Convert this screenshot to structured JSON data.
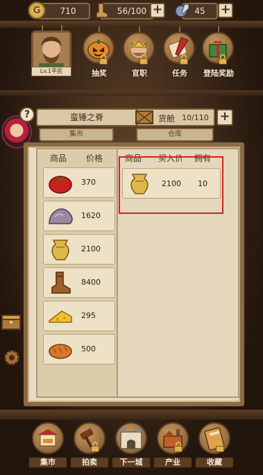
{
  "resources": {
    "coins": "710",
    "stamina": "56/100",
    "potion": "45"
  },
  "player": {
    "level_title": "Lv.1平民"
  },
  "top_menu": [
    {
      "label": "抽奖",
      "icon": "pumpkin-icon"
    },
    {
      "label": "官职",
      "icon": "king-icon"
    },
    {
      "label": "任务",
      "icon": "scroll-icon"
    },
    {
      "label": "登陆奖励",
      "icon": "gift-icon"
    }
  ],
  "header": {
    "location_name": "蛮锤之脊",
    "cargo_label": "货舱",
    "cargo_value": "10/110",
    "tab_market": "集市",
    "tab_warehouse": "仓库",
    "hint_symbol": "?"
  },
  "market": {
    "headers": {
      "item": "商品",
      "price": "价格"
    },
    "items": [
      {
        "icon": "tomato-icon",
        "price": "370"
      },
      {
        "icon": "stone-icon",
        "price": "1620"
      },
      {
        "icon": "golden-vase-icon",
        "price": "2100"
      },
      {
        "icon": "boot-icon",
        "price": "8400"
      },
      {
        "icon": "cheese-icon",
        "price": "295"
      },
      {
        "icon": "bread-icon",
        "price": "500"
      }
    ]
  },
  "warehouse": {
    "headers": {
      "item": "商品",
      "buy_price": "买入价",
      "owned": "拥有"
    },
    "items": [
      {
        "icon": "golden-vase-icon",
        "buy_price": "2100",
        "owned": "10"
      }
    ]
  },
  "bottom_nav": [
    {
      "label": "集市",
      "icon": "market-stall-icon"
    },
    {
      "label": "拍卖",
      "icon": "gavel-icon"
    },
    {
      "label": "下一城",
      "icon": "castle-gate-icon"
    },
    {
      "label": "产业",
      "icon": "factory-icon"
    },
    {
      "label": "收藏",
      "icon": "book-icon"
    }
  ],
  "colors": {
    "highlight_border": "#d42020",
    "panel_bg": "#e8dcc2",
    "wood_frame": "#8a6a44"
  }
}
